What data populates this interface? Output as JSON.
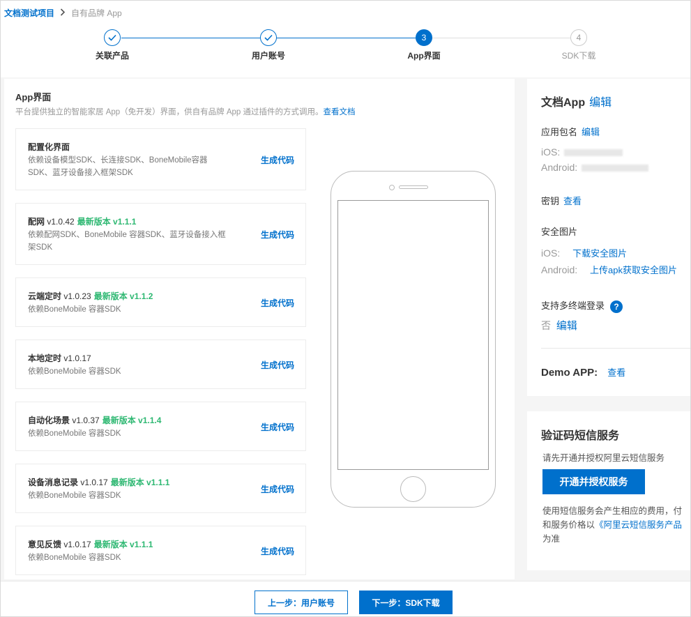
{
  "breadcrumb": {
    "parent": "文档测试项目",
    "current": "自有品牌 App"
  },
  "steps": [
    {
      "label": "关联产品",
      "state": "done",
      "num": ""
    },
    {
      "label": "用户账号",
      "state": "done",
      "num": ""
    },
    {
      "label": "App界面",
      "state": "active",
      "num": "3"
    },
    {
      "label": "SDK下载",
      "state": "todo",
      "num": "4"
    }
  ],
  "panel": {
    "title": "App界面",
    "desc": "平台提供独立的智能家居 App（免开发）界面，供自有品牌 App 通过插件的方式调用。",
    "doc_link": "查看文档"
  },
  "sdk_cards": [
    {
      "name": "配置化界面",
      "version": "",
      "latest": "",
      "desc": "依赖设备模型SDK、长连接SDK、BoneMobile容器SDK、蓝牙设备接入框架SDK",
      "action": "生成代码"
    },
    {
      "name": "配网",
      "version": " v1.0.42",
      "latest": "最新版本 v1.1.1",
      "desc": "依赖配网SDK、BoneMobile 容器SDK、蓝牙设备接入框架SDK",
      "action": "生成代码"
    },
    {
      "name": "云端定时",
      "version": " v1.0.23",
      "latest": "最新版本 v1.1.2",
      "desc": "依赖BoneMobile 容器SDK",
      "action": "生成代码"
    },
    {
      "name": "本地定时",
      "version": " v1.0.17",
      "latest": "",
      "desc": "依赖BoneMobile 容器SDK",
      "action": "生成代码"
    },
    {
      "name": "自动化场景",
      "version": " v1.0.37",
      "latest": "最新版本 v1.1.4",
      "desc": "依赖BoneMobile 容器SDK",
      "action": "生成代码"
    },
    {
      "name": "设备消息记录",
      "version": " v1.0.17",
      "latest": "最新版本 v1.1.1",
      "desc": "依赖BoneMobile 容器SDK",
      "action": "生成代码"
    },
    {
      "name": "意见反馈",
      "version": " v1.0.17",
      "latest": "最新版本 v1.1.1",
      "desc": "依赖BoneMobile 容器SDK",
      "action": "生成代码"
    }
  ],
  "app_info": {
    "title": "文档App",
    "edit": "编辑",
    "package_label": "应用包名",
    "package_edit": "编辑",
    "ios_label": "iOS:",
    "android_label": "Android:",
    "secret_label": "密钥",
    "secret_view": "查看",
    "secure_image_label": "安全图片",
    "secure_ios_label": "iOS:",
    "secure_ios_action": "下载安全图片",
    "secure_android_label": "Android:",
    "secure_android_action": "上传apk获取安全图片",
    "multi_login_label": "支持多终端登录",
    "multi_login_value": "否",
    "multi_login_edit": "编辑",
    "help_glyph": "?",
    "demo_label": "Demo APP:",
    "demo_view": "查看"
  },
  "sms": {
    "title": "验证码短信服务",
    "prompt": "请先开通并授权阿里云短信服务",
    "button": "开通并授权服务",
    "note_line1": "使用短信服务会产生相应的费用，付",
    "note_line2_prefix": "和服务价格以",
    "note_line2_link": "《阿里云短信服务产品",
    "note_line3": "为准"
  },
  "footer": {
    "prev": "上一步：用户账号",
    "next": "下一步：SDK下载"
  },
  "colors": {
    "primary": "#0070cc",
    "latest": "#2eb872",
    "muted": "#999999"
  },
  "icons": {
    "step_done": "check-icon",
    "breadcrumb_sep": "chevron-right-icon",
    "help": "question-icon"
  }
}
